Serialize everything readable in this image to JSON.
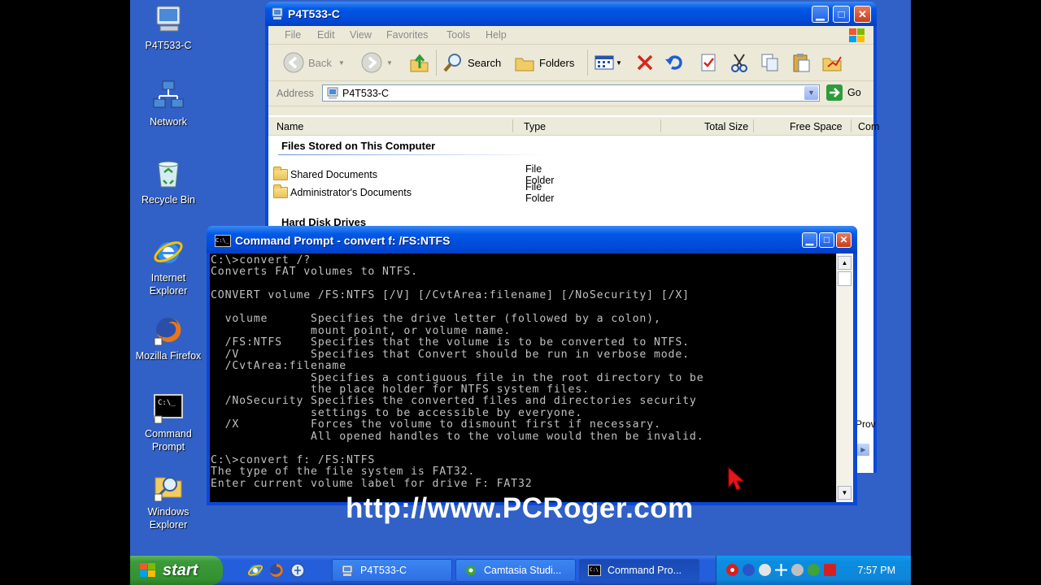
{
  "desktop": {
    "icons": [
      {
        "label": "P4T533-C",
        "icon": "my-computer-icon"
      },
      {
        "label": "Network",
        "icon": "network-icon"
      },
      {
        "label": "Recycle Bin",
        "icon": "recycle-bin-icon"
      },
      {
        "label_line1": "Internet",
        "label_line2": "Explorer",
        "icon": "internet-explorer-icon"
      },
      {
        "label": "Mozilla Firefox",
        "icon": "firefox-icon"
      },
      {
        "label_line1": "Command",
        "label_line2": "Prompt",
        "icon": "command-prompt-icon"
      },
      {
        "label_line1": "Windows",
        "label_line2": "Explorer",
        "icon": "windows-explorer-icon"
      }
    ]
  },
  "explorer": {
    "title": "P4T533-C",
    "menu": [
      "File",
      "Edit",
      "View",
      "Favorites",
      "Tools",
      "Help"
    ],
    "toolbar": {
      "back": "Back",
      "search": "Search",
      "folders": "Folders"
    },
    "address": {
      "label": "Address",
      "value": "P4T533-C",
      "go": "Go"
    },
    "columns": [
      "Name",
      "Type",
      "Total Size",
      "Free Space",
      "Com"
    ],
    "groups": {
      "files": "Files Stored on This Computer",
      "drives": "Hard Disk Drives"
    },
    "rows": [
      {
        "name": "Shared Documents",
        "type": "File Folder"
      },
      {
        "name": "Administrator's Documents",
        "type": "File Folder"
      }
    ],
    "partial_right_text": "Prov"
  },
  "cmd": {
    "title": "Command Prompt - convert f: /FS:NTFS",
    "icon_text": "C:\\_",
    "lines": [
      "C:\\>convert /?",
      "Converts FAT volumes to NTFS.",
      "",
      "CONVERT volume /FS:NTFS [/V] [/CvtArea:filename] [/NoSecurity] [/X]",
      "",
      "  volume      Specifies the drive letter (followed by a colon),",
      "              mount point, or volume name.",
      "  /FS:NTFS    Specifies that the volume is to be converted to NTFS.",
      "  /V          Specifies that Convert should be run in verbose mode.",
      "  /CvtArea:filename",
      "              Specifies a contiguous file in the root directory to be",
      "              the place holder for NTFS system files.",
      "  /NoSecurity Specifies the converted files and directories security",
      "              settings to be accessible by everyone.",
      "  /X          Forces the volume to dismount first if necessary.",
      "              All opened handles to the volume would then be invalid.",
      "",
      "C:\\>convert f: /FS:NTFS",
      "The type of the file system is FAT32.",
      "Enter current volume label for drive F: FAT32"
    ]
  },
  "watermark": "http://www.PCRoger.com",
  "taskbar": {
    "start": "start",
    "tasks": [
      {
        "label": "P4T533-C",
        "icon": "my-computer-icon"
      },
      {
        "label": "Camtasia Studi...",
        "icon": "camtasia-icon"
      },
      {
        "label": "Command Pro...",
        "icon": "command-prompt-icon"
      }
    ],
    "clock": "7:57 PM"
  },
  "colors": {
    "desktop": "#3161c6",
    "titlebar": "#0058e6",
    "console_bg": "#000000",
    "console_fg": "#c0c0c0",
    "start": "#3c9a3a",
    "tray": "#0c8ddf"
  }
}
